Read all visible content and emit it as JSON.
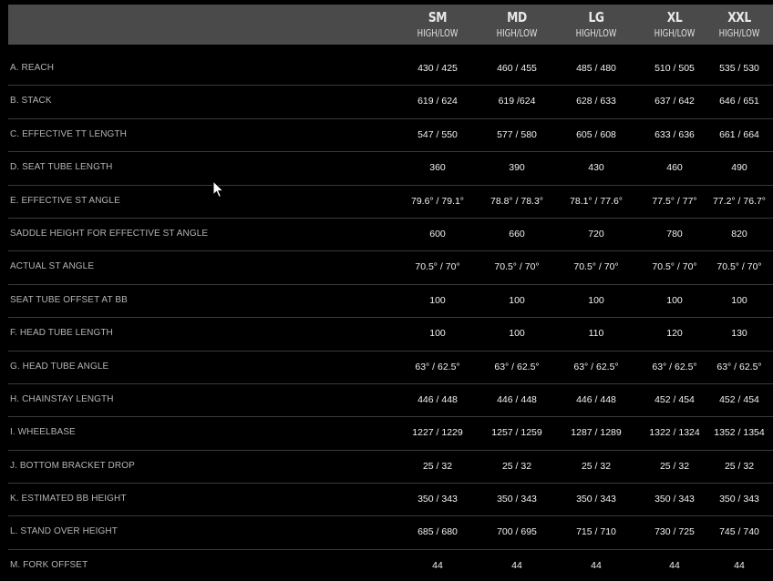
{
  "sizes": [
    {
      "name": "SM",
      "sub": "HIGH/LOW"
    },
    {
      "name": "MD",
      "sub": "HIGH/LOW"
    },
    {
      "name": "LG",
      "sub": "HIGH/LOW"
    },
    {
      "name": "XL",
      "sub": "HIGH/LOW"
    },
    {
      "name": "XXL",
      "sub": "HIGH/LOW"
    }
  ],
  "rows": [
    {
      "label": "A. REACH",
      "values": [
        "430 / 425",
        "460 / 455",
        "485 / 480",
        "510 / 505",
        "535 / 530"
      ]
    },
    {
      "label": "B. STACK",
      "values": [
        "619 / 624",
        "619 /624",
        "628 / 633",
        "637 / 642",
        "646 / 651"
      ]
    },
    {
      "label": "C. EFFECTIVE TT LENGTH",
      "values": [
        "547 / 550",
        "577 / 580",
        "605 / 608",
        "633 / 636",
        "661 / 664"
      ]
    },
    {
      "label": "D. SEAT TUBE LENGTH",
      "values": [
        "360",
        "390",
        "430",
        "460",
        "490"
      ]
    },
    {
      "label": "E. EFFECTIVE ST ANGLE",
      "values": [
        "79.6° / 79.1°",
        "78.8° / 78.3°",
        "78.1° / 77.6°",
        "77.5° / 77°",
        "77.2° / 76.7°"
      ]
    },
    {
      "label": "SADDLE HEIGHT FOR EFFECTIVE ST ANGLE",
      "values": [
        "600",
        "660",
        "720",
        "780",
        "820"
      ]
    },
    {
      "label": "ACTUAL ST ANGLE",
      "values": [
        "70.5° / 70°",
        "70.5° / 70°",
        "70.5° / 70°",
        "70.5° / 70°",
        "70.5° / 70°"
      ]
    },
    {
      "label": "SEAT TUBE OFFSET AT BB",
      "values": [
        "100",
        "100",
        "100",
        "100",
        "100"
      ]
    },
    {
      "label": "F. HEAD TUBE LENGTH",
      "values": [
        "100",
        "100",
        "110",
        "120",
        "130"
      ]
    },
    {
      "label": "G. HEAD TUBE ANGLE",
      "values": [
        "63° / 62.5°",
        "63° / 62.5°",
        "63° / 62.5°",
        "63° / 62.5°",
        "63° / 62.5°"
      ]
    },
    {
      "label": "H. CHAINSTAY LENGTH",
      "values": [
        "446 / 448",
        "446 / 448",
        "446 / 448",
        "452 / 454",
        "452 / 454"
      ]
    },
    {
      "label": "I. WHEELBASE",
      "values": [
        "1227 / 1229",
        "1257 / 1259",
        "1287 / 1289",
        "1322 / 1324",
        "1352 / 1354"
      ]
    },
    {
      "label": "J. BOTTOM BRACKET DROP",
      "values": [
        "25 / 32",
        "25 / 32",
        "25 / 32",
        "25 / 32",
        "25 / 32"
      ]
    },
    {
      "label": "K. ESTIMATED BB HEIGHT",
      "values": [
        "350 / 343",
        "350 / 343",
        "350 / 343",
        "350 / 343",
        "350 / 343"
      ]
    },
    {
      "label": "L. STAND OVER HEIGHT",
      "values": [
        "685 / 680",
        "700 / 695",
        "715 / 710",
        "730 / 725",
        "745 / 740"
      ]
    },
    {
      "label": "M. FORK OFFSET",
      "values": [
        "44",
        "44",
        "44",
        "44",
        "44"
      ]
    }
  ],
  "colors": {
    "background": "#000000",
    "header_bg": "#4a4a4a",
    "divider": "#3a3a3a",
    "label_text": "#b5b5b5",
    "value_text": "#f2f2f2"
  },
  "icons": {
    "cursor": "mouse-pointer-icon"
  }
}
